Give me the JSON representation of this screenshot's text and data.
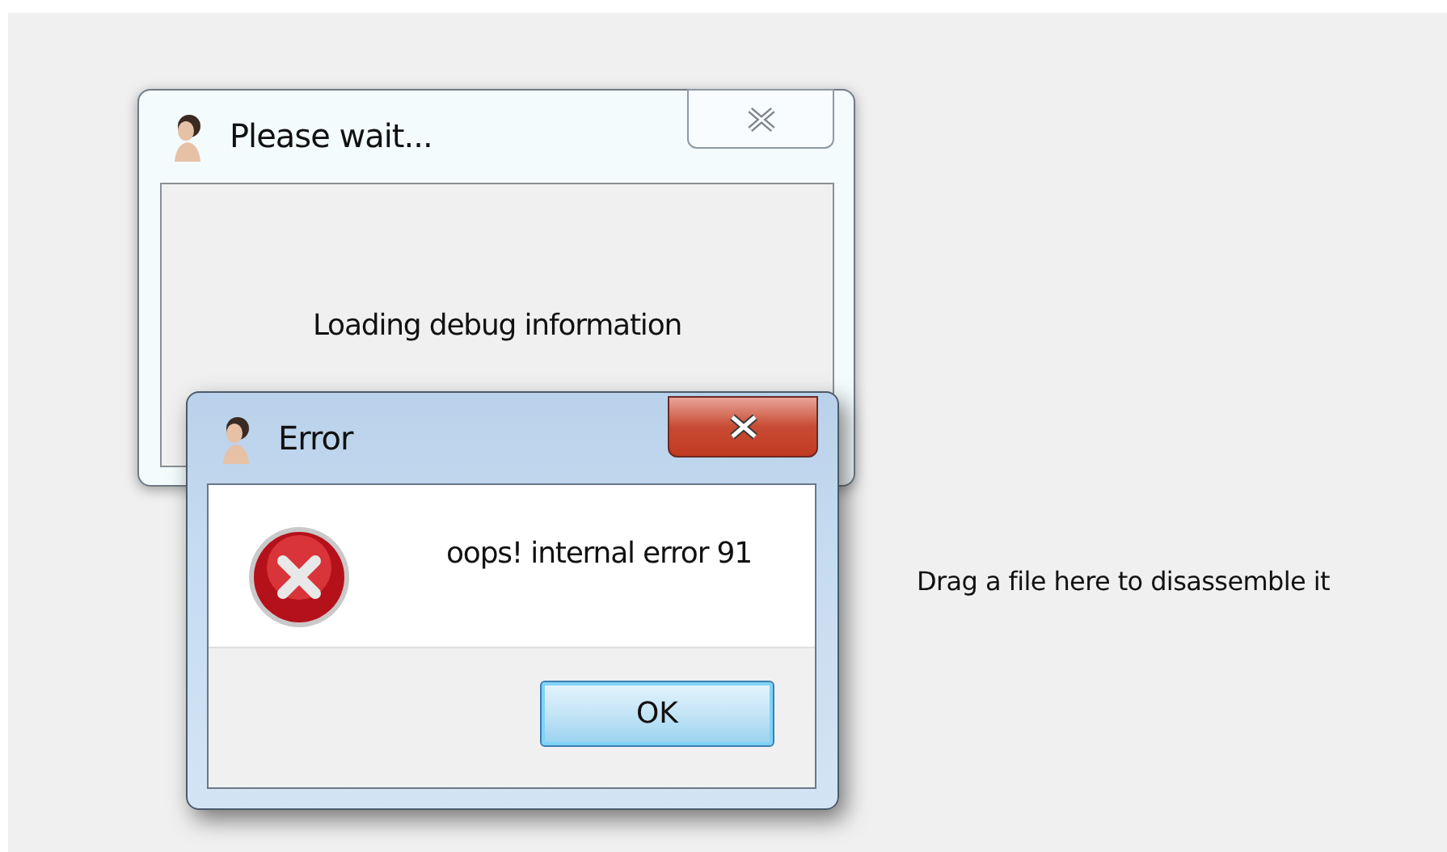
{
  "drop_hint": "Drag a file here to disassemble it",
  "windows": [
    {
      "title": "Please wait...",
      "active": false,
      "message": "Loading debug information"
    },
    {
      "title": "Error",
      "active": true,
      "kind": "error",
      "message": "oops! internal error 91",
      "buttons": [
        "OK"
      ]
    }
  ]
}
